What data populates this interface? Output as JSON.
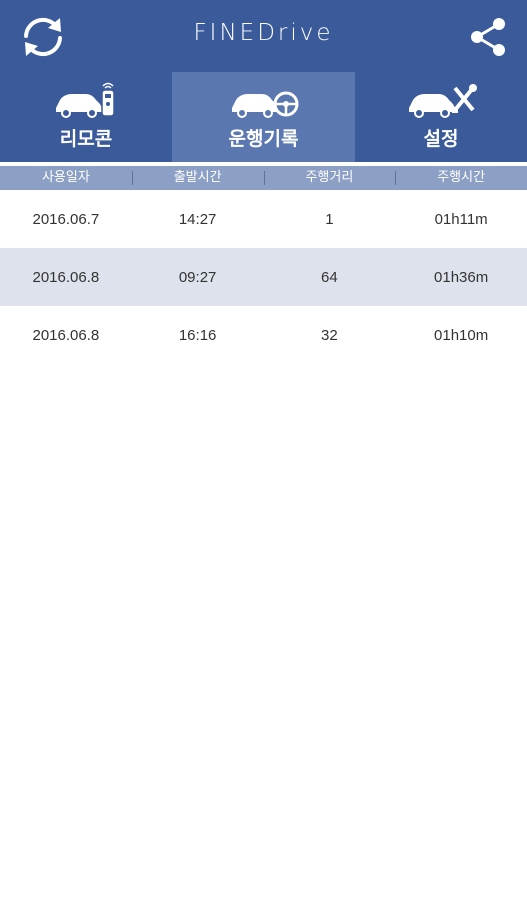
{
  "app": {
    "title": "FINEDrive"
  },
  "icons": {
    "sync": "sync-icon",
    "share": "share-icon",
    "remote": "car-remote-icon",
    "log": "car-steering-wheel-icon",
    "settings": "car-tools-icon"
  },
  "colors": {
    "header": "#3a5a9a",
    "active_tab": "#5b77b0",
    "column_header": "#8c9fc4",
    "alt_row": "#dde2ec"
  },
  "tabs": [
    {
      "label": "리모콘",
      "active": false
    },
    {
      "label": "운행기록",
      "active": true
    },
    {
      "label": "설정",
      "active": false
    }
  ],
  "table": {
    "headers": [
      "사용일자",
      "출발시간",
      "주행거리",
      "주행시간"
    ],
    "rows": [
      [
        "2016.06.7",
        "14:27",
        "1",
        "01h11m"
      ],
      [
        "2016.06.8",
        "09:27",
        "64",
        "01h36m"
      ],
      [
        "2016.06.8",
        "16:16",
        "32",
        "01h10m"
      ]
    ]
  }
}
